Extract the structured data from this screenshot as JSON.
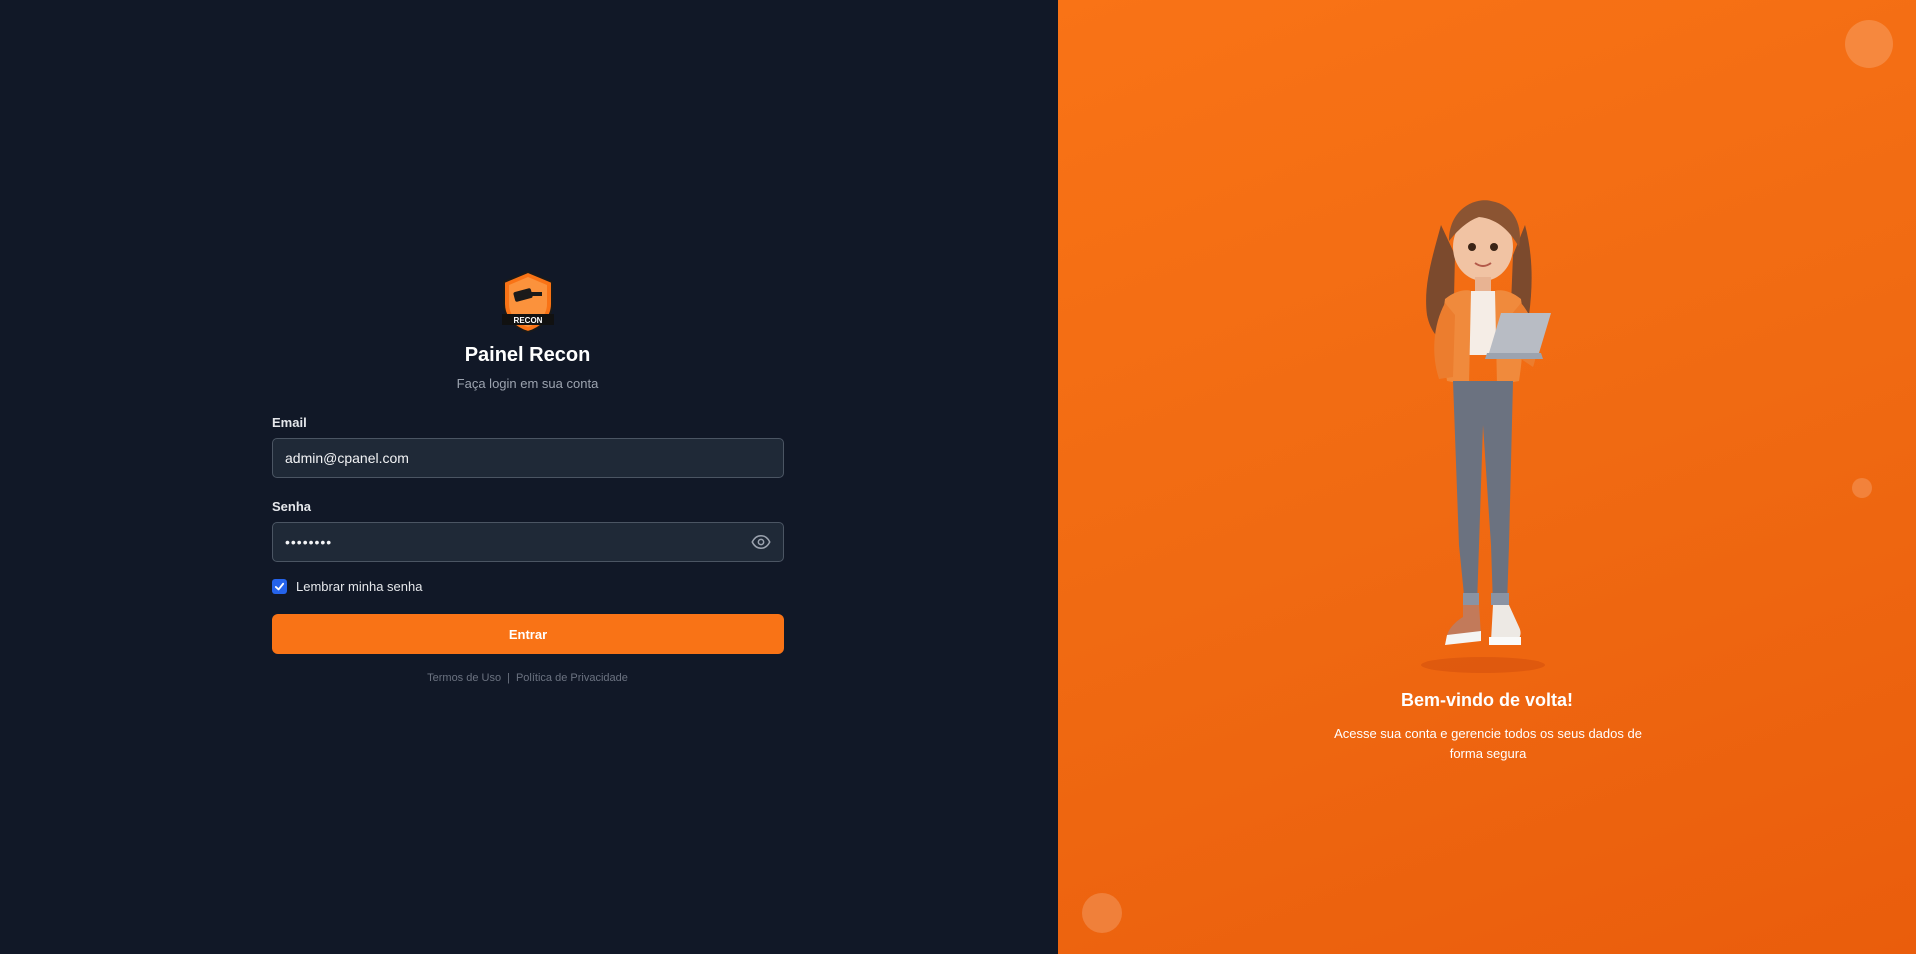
{
  "brand": {
    "logo_text": "RECON",
    "title": "Painel Recon",
    "subtitle": "Faça login em sua conta"
  },
  "form": {
    "email_label": "Email",
    "email_value": "admin@cpanel.com",
    "password_label": "Senha",
    "password_value": "••••••••",
    "remember_label": "Lembrar minha senha",
    "remember_checked": true,
    "submit_label": "Entrar"
  },
  "footer": {
    "terms": "Termos de Uso",
    "separator": "|",
    "privacy": "Política de Privacidade"
  },
  "hero": {
    "heading": "Bem-vindo de volta!",
    "text": "Acesse sua conta e gerencie todos os seus dados de forma segura"
  },
  "colors": {
    "accent": "#f97316",
    "background": "#111827",
    "input_bg": "#1f2937",
    "checkbox": "#2563eb"
  },
  "icons": {
    "password_toggle": "eye-icon",
    "checkbox": "check-icon"
  }
}
